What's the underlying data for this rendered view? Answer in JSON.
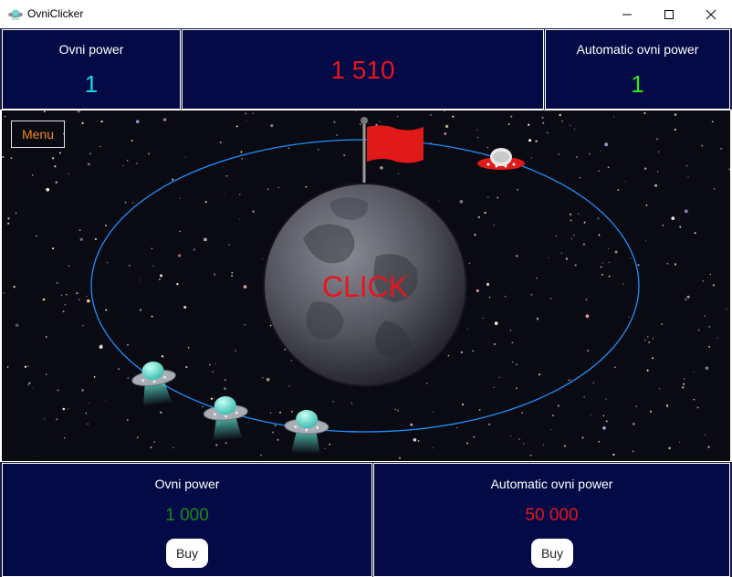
{
  "window": {
    "title": "OvniClicker",
    "icon": "ufo-icon"
  },
  "stats": {
    "ovni_power": {
      "label": "Ovni power",
      "value": "1",
      "color": "#1ad9d9"
    },
    "score": {
      "value": "1 510",
      "color": "#e8141e"
    },
    "automatic_ovni_power": {
      "label": "Automatic ovni power",
      "value": "1",
      "color": "#2ce81a"
    }
  },
  "game": {
    "menu_label": "Menu",
    "click_label": "CLICK",
    "click_color": "#e8141e",
    "orbit_color": "#1e90ff",
    "flag_color": "#e01919"
  },
  "shop": {
    "ovni_power": {
      "label": "Ovni power",
      "price": "1 000",
      "price_color": "#1a8c1a",
      "buy_label": "Buy"
    },
    "automatic_ovni_power": {
      "label": "Automatic ovni power",
      "price": "50 000",
      "price_color": "#e8141e",
      "buy_label": "Buy"
    }
  }
}
